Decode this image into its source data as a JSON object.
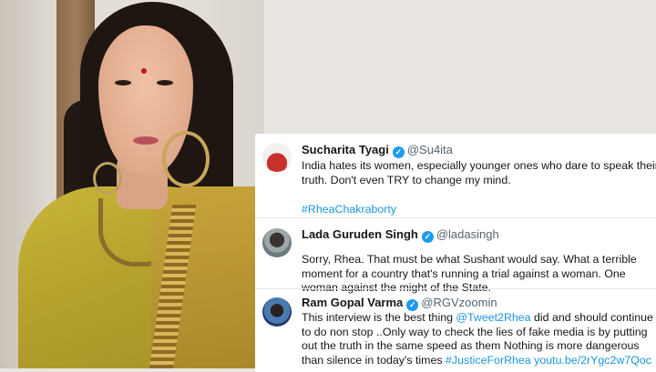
{
  "tweets": [
    {
      "name": "Sucharita Tyagi",
      "handle": "@Su4ita",
      "text": "India hates its women, especially younger ones who dare to speak their truth. Don't even TRY to change my mind.",
      "hashtag": "#RheaChakraborty"
    },
    {
      "name": "Lada Guruden Singh",
      "handle": "@ladasingh",
      "text": "Sorry, Rhea. That must be what Sushant would say. What a terrible moment for a country that's running a trial against a woman. One woman against the might of the State."
    },
    {
      "name": "Ram Gopal Varma",
      "handle": "@RGVzoomin",
      "text_before": "This interview is the best thing ",
      "mention": "@Tweet2Rhea",
      "text_after": " did and should continue to do non stop ..Only way to check the lies of fake media is by putting out the truth in the same speed as them  Nothing is more dangerous than silence in today's times ",
      "hashtag": "#JusticeForRhea",
      "link": "youtu.be/2rYgc2w7Qoc"
    }
  ],
  "icons": {
    "verified": "verified-badge-icon",
    "checkmark": "✓"
  },
  "colors": {
    "link": "#1b95e0",
    "verified": "#1d9bf0"
  }
}
